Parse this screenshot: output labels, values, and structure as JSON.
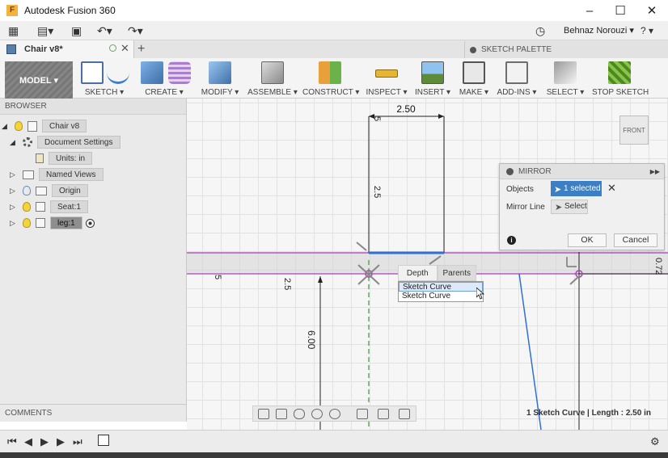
{
  "window": {
    "title": "Autodesk Fusion 360",
    "controls": [
      "–",
      "☐",
      "✕"
    ]
  },
  "quick_access": {
    "user": "Behnaz Norouzi ▾",
    "help": "? ▾"
  },
  "doc_tab": {
    "name": "Chair v8*",
    "new_tab": "+"
  },
  "palette": {
    "header": "SKETCH PALETTE"
  },
  "toolbar": {
    "workspace": "MODEL ▾",
    "groups": [
      {
        "label": "SKETCH ▾"
      },
      {
        "label": "CREATE ▾"
      },
      {
        "label": "MODIFY ▾"
      },
      {
        "label": "ASSEMBLE ▾"
      },
      {
        "label": "CONSTRUCT ▾"
      },
      {
        "label": "INSPECT ▾"
      },
      {
        "label": "INSERT ▾"
      },
      {
        "label": "MAKE ▾"
      },
      {
        "label": "ADD-INS ▾"
      },
      {
        "label": "SELECT ▾"
      },
      {
        "label": "STOP SKETCH"
      }
    ]
  },
  "browser": {
    "header": "BROWSER",
    "items": [
      {
        "label": "Chair v8"
      },
      {
        "label": "Document Settings"
      },
      {
        "label": "Units: in"
      },
      {
        "label": "Named Views"
      },
      {
        "label": "Origin"
      },
      {
        "label": "Seat:1"
      },
      {
        "label": "leg:1"
      }
    ]
  },
  "comments": "COMMENTS",
  "viewcube": {
    "label": "FRONT"
  },
  "dimensions": {
    "width": "2.50",
    "vert_left": "2.5",
    "lower": "2.5",
    "height": "6.00",
    "right": "0.72",
    "left_edge": "5"
  },
  "mirror": {
    "title": "MIRROR",
    "objects_label": "Objects",
    "objects_value": "1 selected",
    "mirror_line_label": "Mirror Line",
    "mirror_line_value": "Select",
    "ok": "OK",
    "cancel": "Cancel"
  },
  "context_menu": {
    "tabs": [
      "Depth",
      "Parents"
    ],
    "items": [
      "Sketch Curve",
      "Sketch Curve"
    ]
  },
  "status": "1 Sketch Curve | Length : 2.50 in",
  "colors": {
    "accent": "#3c7fc4",
    "profile_line": "#b040b8",
    "sketch_blue": "#2f6fd6",
    "construction": "#3a9a3a"
  }
}
